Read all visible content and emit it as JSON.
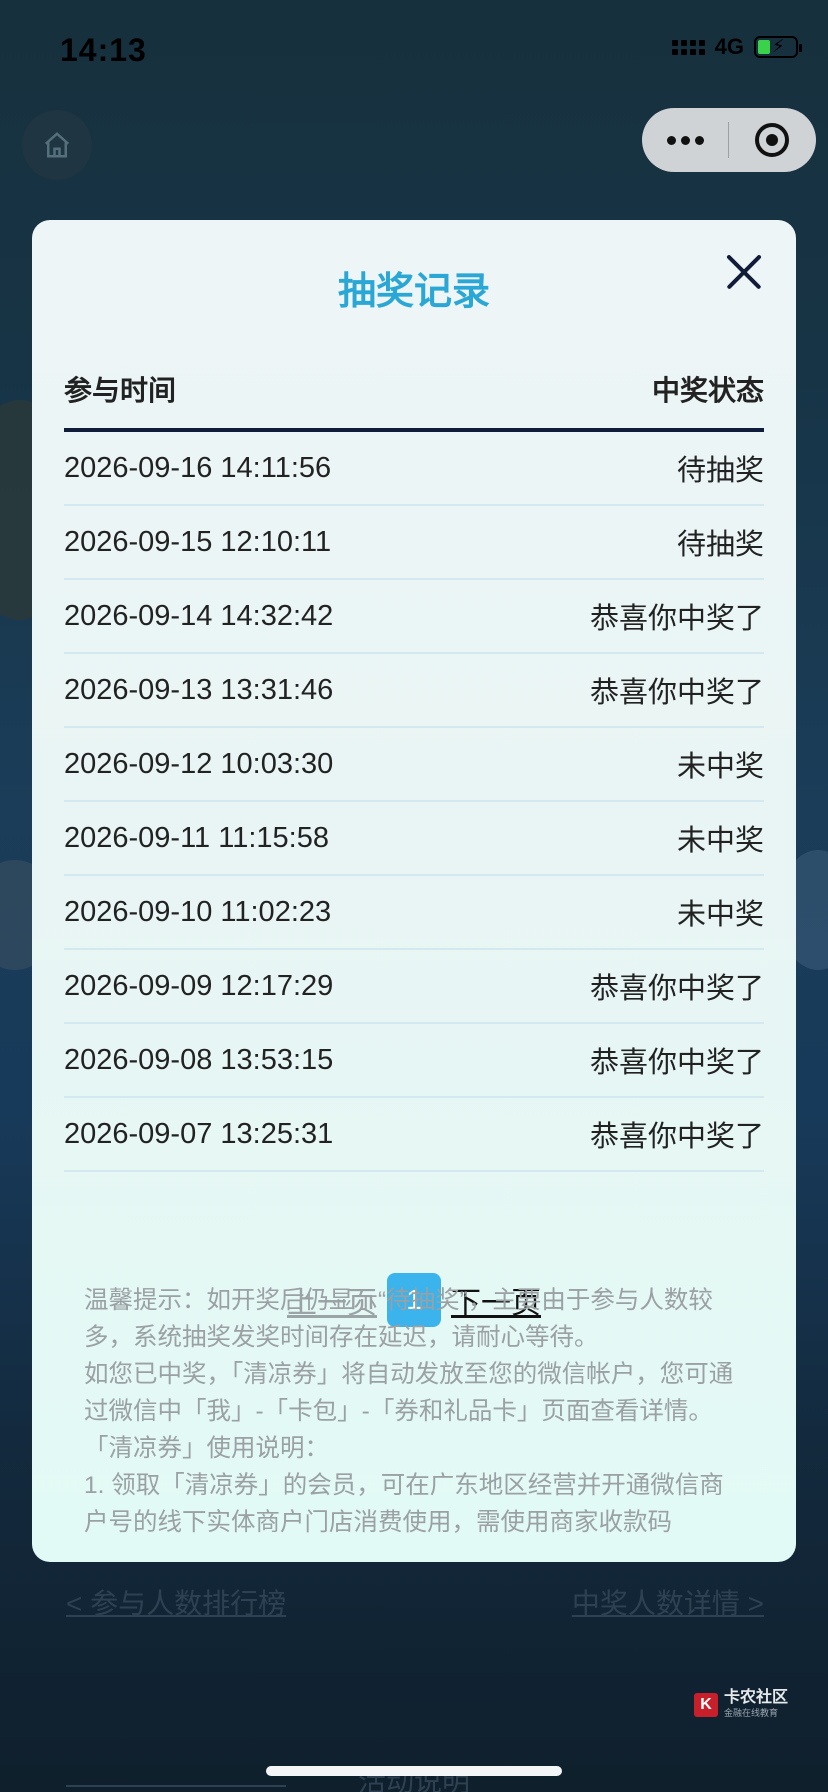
{
  "status_bar": {
    "time": "14:13",
    "network": "4G"
  },
  "modal": {
    "title": "抽奖记录",
    "columns": {
      "time": "参与时间",
      "status": "中奖状态"
    },
    "rows": [
      {
        "time": "2026-09-16 14:11:56",
        "status": "待抽奖"
      },
      {
        "time": "2026-09-15 12:10:11",
        "status": "待抽奖"
      },
      {
        "time": "2026-09-14 14:32:42",
        "status": "恭喜你中奖了"
      },
      {
        "time": "2026-09-13 13:31:46",
        "status": "恭喜你中奖了"
      },
      {
        "time": "2026-09-12 10:03:30",
        "status": "未中奖"
      },
      {
        "time": "2026-09-11 11:15:58",
        "status": "未中奖"
      },
      {
        "time": "2026-09-10 11:02:23",
        "status": "未中奖"
      },
      {
        "time": "2026-09-09 12:17:29",
        "status": "恭喜你中奖了"
      },
      {
        "time": "2026-09-08 13:53:15",
        "status": "恭喜你中奖了"
      },
      {
        "time": "2026-09-07 13:25:31",
        "status": "恭喜你中奖了"
      }
    ],
    "pagination": {
      "prev": "上一页",
      "current": "1",
      "next": "下一页"
    },
    "notes": [
      "温馨提示：如开奖后仍显示“待抽奖”，主要由于参与人数较多，系统抽奖发奖时间存在延迟，请耐心等待。",
      "如您已中奖，「清凉券」将自动发放至您的微信帐户，您可通过微信中「我」-「卡包」-「券和礼品卡」页面查看详情。",
      "「清凉券」使用说明：",
      "1. 领取「清凉券」的会员，可在广东地区经营并开通微信商户号的线下实体商户门店消费使用，需使用商家收款码"
    ]
  },
  "page_links": {
    "left": "< 参与人数排行榜",
    "right": "中奖人数详情 >"
  },
  "page_section_title": "活动说明",
  "watermark": {
    "name": "卡农社区",
    "sub": "金融在线教育"
  },
  "colors": {
    "accent": "#2ba7d6",
    "page_active": "#3bb3ec",
    "header_rule": "#0f1d3a"
  }
}
